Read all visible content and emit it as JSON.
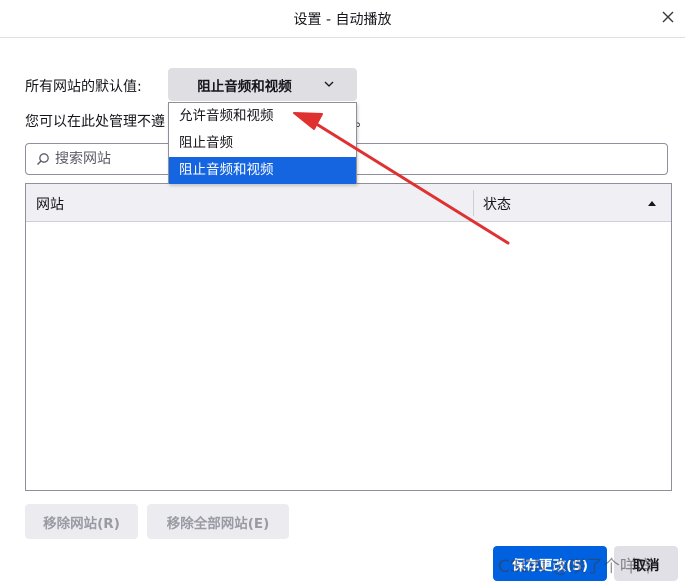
{
  "window": {
    "title": "设置 - 自动播放"
  },
  "autoplay": {
    "default_label": "所有网站的默认值:",
    "selected_value": "阻止音频和视频",
    "description_start": "您可以在此处管理不遵",
    "description_end": "。",
    "options": [
      {
        "label": "允许音频和视频",
        "selected": false
      },
      {
        "label": "阻止音频",
        "selected": false
      },
      {
        "label": "阻止音频和视频",
        "selected": true
      }
    ]
  },
  "search": {
    "placeholder": "搜索网站"
  },
  "table": {
    "columns": [
      "网站",
      "状态"
    ],
    "sort_column": "状态",
    "sort_direction": "ascending",
    "rows": []
  },
  "buttons": {
    "remove_site": "移除网站(R)",
    "remove_all": "移除全部网站(E)",
    "save": "保存更改(S)",
    "cancel": "取消"
  },
  "annotation": {
    "arrow_color": "#e03131",
    "points_to": "允许音频和视频"
  },
  "watermark": "CSDN @咲了个咩咩"
}
